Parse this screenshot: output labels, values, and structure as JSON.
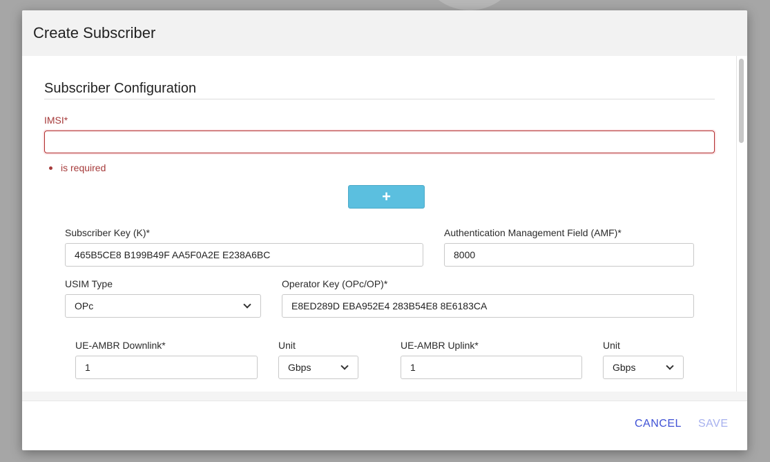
{
  "dialog": {
    "title": "Create Subscriber"
  },
  "section": {
    "title": "Subscriber Configuration"
  },
  "imsi": {
    "label": "IMSI*",
    "value": "",
    "error": "is required"
  },
  "add_button": {
    "label": "+"
  },
  "subscriber_key": {
    "label": "Subscriber Key (K)*",
    "value": "465B5CE8 B199B49F AA5F0A2E E238A6BC"
  },
  "amf": {
    "label": "Authentication Management Field (AMF)*",
    "value": "8000"
  },
  "usim_type": {
    "label": "USIM Type",
    "selected": "OPc"
  },
  "operator_key": {
    "label": "Operator Key (OPc/OP)*",
    "value": "E8ED289D EBA952E4 283B54E8 8E6183CA"
  },
  "ue_ambr_downlink": {
    "label": "UE-AMBR Downlink*",
    "value": "1",
    "unit_label": "Unit",
    "unit_selected": "Gbps"
  },
  "ue_ambr_uplink": {
    "label": "UE-AMBR Uplink*",
    "value": "1",
    "unit_label": "Unit",
    "unit_selected": "Gbps"
  },
  "footer": {
    "cancel_label": "CANCEL",
    "save_label": "SAVE"
  },
  "colors": {
    "accent": "#3f51d5",
    "add_button": "#5bbfdf",
    "error": "#a63a3a"
  }
}
